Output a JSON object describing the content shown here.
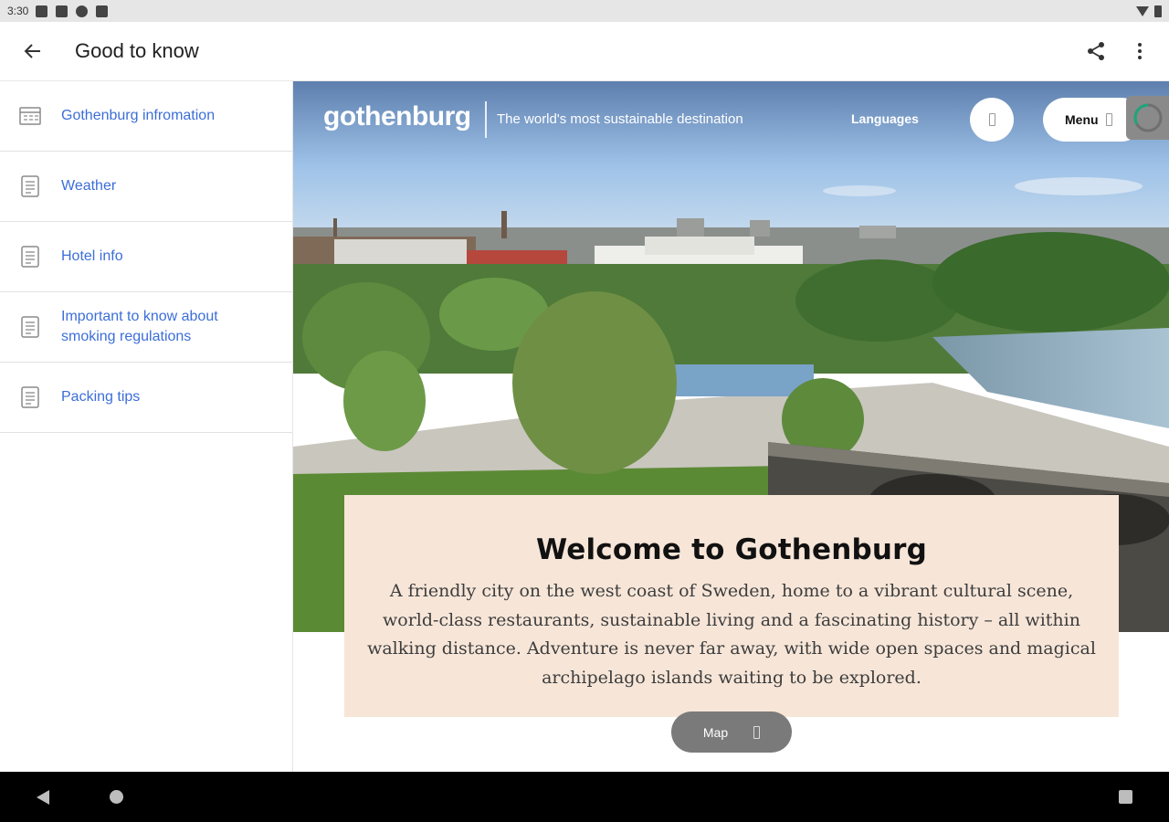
{
  "status_bar": {
    "time": "3:30",
    "icons": [
      "notification-icon",
      "gallery-icon",
      "sync-icon",
      "storage-icon"
    ],
    "right_icons": [
      "wifi-icon",
      "battery-icon"
    ]
  },
  "app_bar": {
    "title": "Good to know",
    "back_icon": "arrow-left-icon",
    "share_icon": "share-icon",
    "more_icon": "more-vert-icon"
  },
  "sidebar": {
    "items": [
      {
        "label": "Gothenburg infromation",
        "icon": "calendar-doc-icon"
      },
      {
        "label": "Weather",
        "icon": "document-icon"
      },
      {
        "label": "Hotel info",
        "icon": "document-icon"
      },
      {
        "label": "Important to know about smoking regulations",
        "icon": "document-icon"
      },
      {
        "label": "Packing tips",
        "icon": "document-icon"
      }
    ]
  },
  "website": {
    "logo": "gothenburg",
    "tagline": "The world's most sustainable destination",
    "languages": "Languages",
    "menu": "Menu",
    "welcome": {
      "title": "Welcome to Gothenburg",
      "text": "A friendly city on the west coast of Sweden, home to a vibrant cultural scene, world-class restaurants, sustainable living and a fascinating history – all within walking distance. Adventure is never far away, with wide open spaces and magical archipelago islands waiting to be explored."
    },
    "map_button": "Map"
  },
  "colors": {
    "link_blue": "#3c6ed8",
    "card_bg": "#f7e6d8",
    "sky": "#9ec2e8"
  },
  "nav_bar": {
    "icons": [
      "nav-back-icon",
      "nav-home-icon",
      "nav-recents-icon"
    ]
  }
}
